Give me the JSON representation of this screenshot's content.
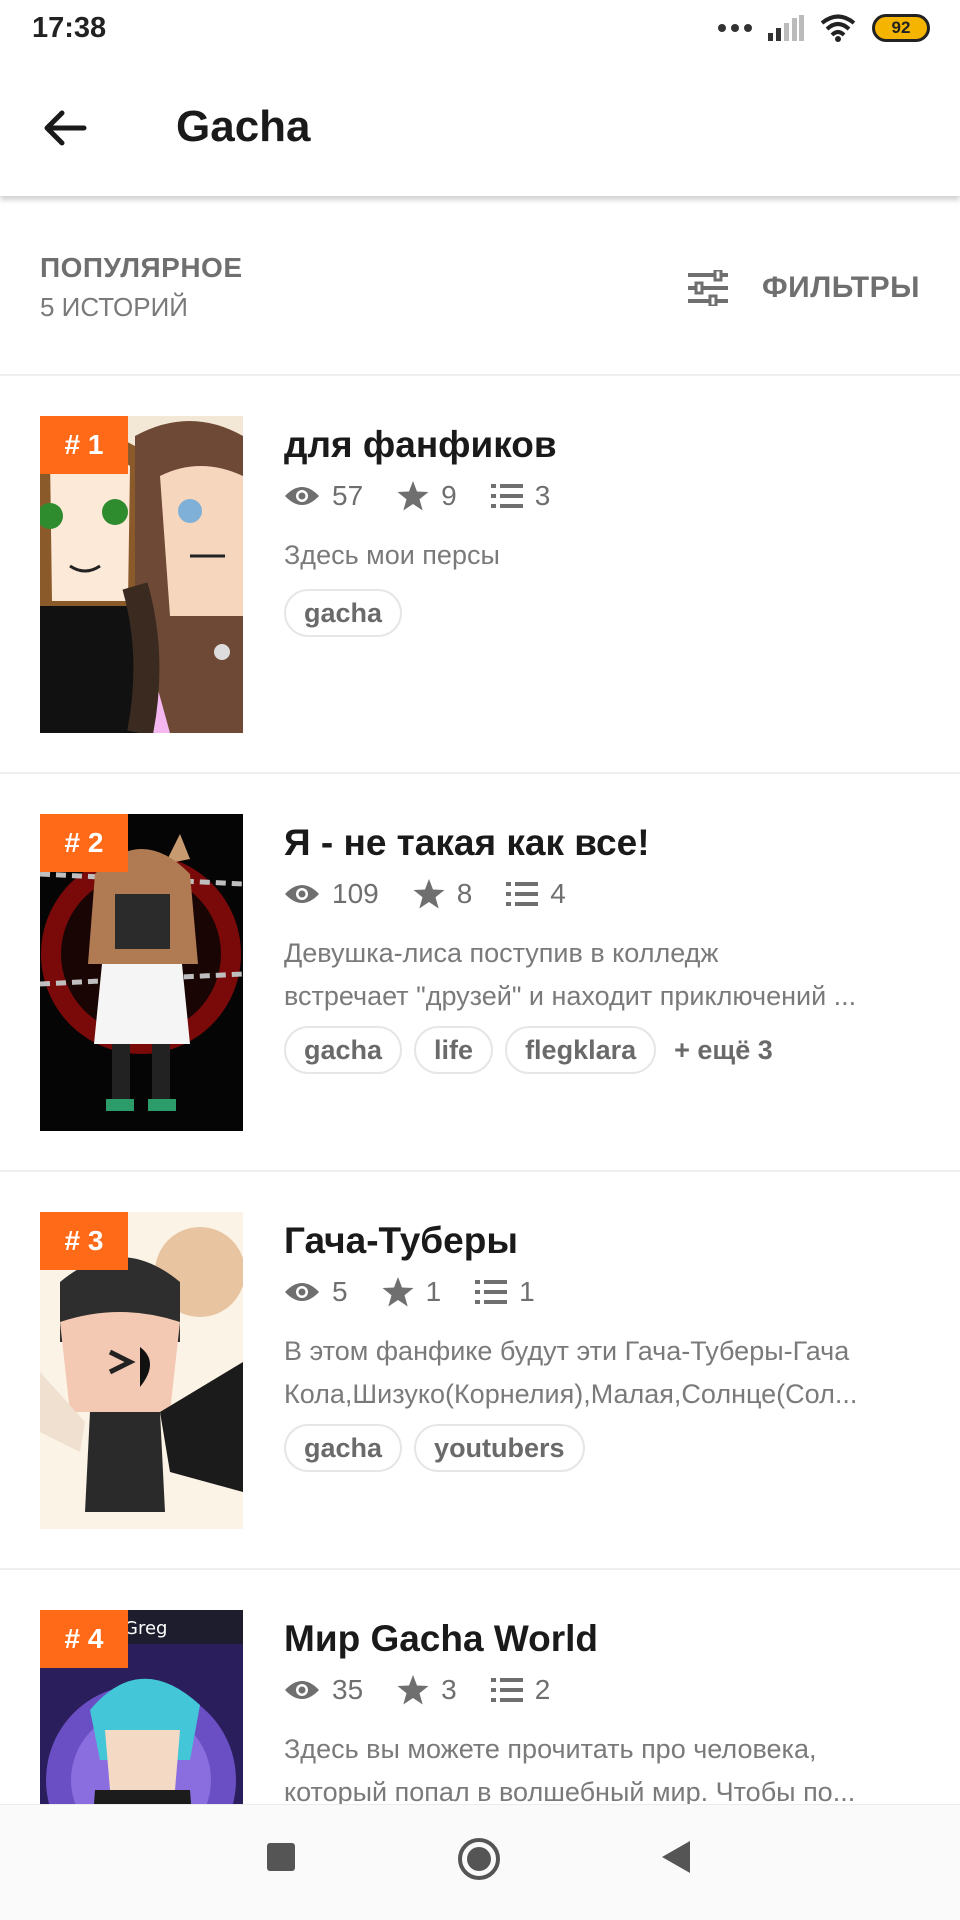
{
  "status": {
    "time": "17:38",
    "battery": "92"
  },
  "appbar": {
    "title": "Gacha"
  },
  "sort": {
    "label": "ПОПУЛЯРНОЕ",
    "count": "5 ИСТОРИЙ",
    "filters_label": "ФИЛЬТРЫ"
  },
  "stories": [
    {
      "rank": "# 1",
      "title": "для фанфиков",
      "views": "57",
      "votes": "9",
      "parts": "3",
      "desc": [
        "Здесь мои персы"
      ],
      "tags": [
        "gacha"
      ],
      "more": ""
    },
    {
      "rank": "# 2",
      "title": "Я - не такая как все!",
      "views": "109",
      "votes": "8",
      "parts": "4",
      "desc": [
        "Девушка-лиса поступив в колледж",
        "встречает \"друзей\" и находит приключений ..."
      ],
      "tags": [
        "gacha",
        "life",
        "flegklara"
      ],
      "more": "+ ещё 3"
    },
    {
      "rank": "# 3",
      "title": "Гача-Туберы",
      "views": "5",
      "votes": "1",
      "parts": "1",
      "desc": [
        "В этом фанфике будут эти Гача-Туберы-Гача",
        "Кола,Шизуко(Корнелия),Малая,Солнце(Сол..."
      ],
      "tags": [
        "gacha",
        "youtubers"
      ],
      "more": ""
    },
    {
      "rank": "# 4",
      "cover_text": "Greg",
      "title": "Мир Gacha World",
      "views": "35",
      "votes": "3",
      "parts": "2",
      "desc": [
        "Здесь вы можете прочитать про человека,",
        "который попал в волшебный мир. Чтобы по..."
      ],
      "tags": [],
      "more": ""
    }
  ],
  "colors": {
    "accent": "#ff6a19",
    "text_muted": "#6f6f6f",
    "divider": "#eeeeee"
  },
  "icons": [
    "back-arrow-icon",
    "filter-sliders-icon",
    "eye-icon",
    "star-icon",
    "list-icon",
    "nav-recents-icon",
    "nav-home-icon",
    "nav-back-icon",
    "wifi-icon",
    "signal-icon",
    "battery-icon"
  ]
}
